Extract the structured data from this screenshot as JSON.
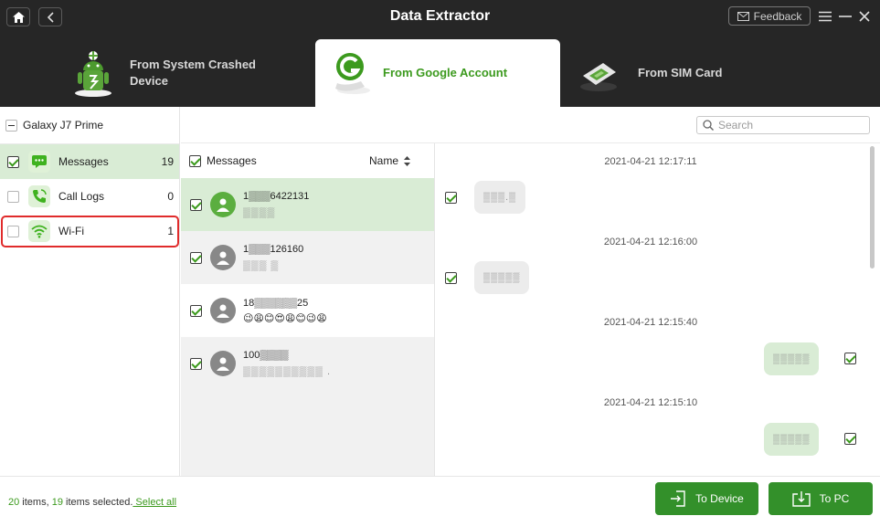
{
  "window": {
    "title": "Data Extractor",
    "feedback_label": "Feedback"
  },
  "tabs": [
    {
      "label_line1": "From System Crashed",
      "label_line2": "Device",
      "active": false
    },
    {
      "label_line1": "From Google Account",
      "active": true
    },
    {
      "label_line1": "From SIM Card",
      "active": false
    }
  ],
  "device": {
    "name": "Galaxy J7 Prime"
  },
  "categories": [
    {
      "label": "Messages",
      "count": "19",
      "checked": true,
      "selected": true,
      "icon": "message-icon"
    },
    {
      "label": "Call Logs",
      "count": "0",
      "checked": false,
      "selected": false,
      "icon": "phone-icon"
    },
    {
      "label": "Wi-Fi",
      "count": "1",
      "checked": false,
      "selected": false,
      "icon": "wifi-icon"
    }
  ],
  "search": {
    "placeholder": "Search"
  },
  "list": {
    "header_label": "Messages",
    "sort_label": "Name",
    "items": [
      {
        "title": "1▒▒▒6422131",
        "subtitle": "▒▒▒▒",
        "checked": true
      },
      {
        "title": "1▒▒▒126160",
        "subtitle": "▒▒▒ ▒",
        "checked": true
      },
      {
        "title": "18▒▒▒▒▒▒25",
        "subtitle": "😉😩😊😍😩😊😉😩",
        "checked": true
      },
      {
        "title": "100▒▒▒▒",
        "subtitle": "▒▒▒▒▒▒▒▒▒▒ .",
        "checked": true
      }
    ]
  },
  "conversation": {
    "timestamps": [
      "2021-04-21 12:17:11",
      "2021-04-21 12:16:00",
      "2021-04-21 12:15:40",
      "2021-04-21 12:15:10"
    ],
    "bubbles": [
      {
        "text": "▒▒▒.▒",
        "direction": "in"
      },
      {
        "text": "▒▒▒▒▒",
        "direction": "in"
      },
      {
        "text": "▒▒▒▒▒",
        "direction": "out"
      },
      {
        "text": "▒▒▒▒▒",
        "direction": "out"
      }
    ]
  },
  "footer": {
    "total": "20",
    "items_label": " items, ",
    "selected": "19",
    "selected_label": " items selected.",
    "select_all": " Select all",
    "to_device": "To Device",
    "to_pc": "To PC"
  },
  "colors": {
    "accent": "#3c9a1e",
    "titlebar": "#262626",
    "button": "#33902a",
    "highlight": "#e02b2b"
  }
}
